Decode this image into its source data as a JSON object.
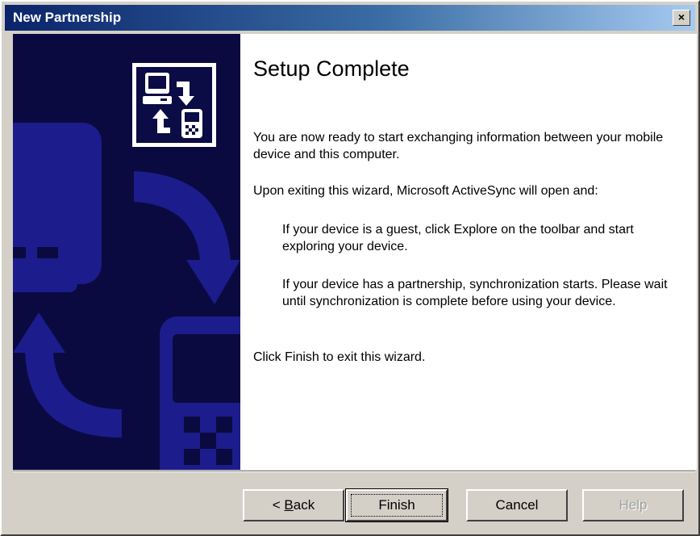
{
  "window": {
    "title": "New Partnership",
    "close_glyph": "×"
  },
  "icons": {
    "banner": "sync-devices-icon",
    "close": "close-icon"
  },
  "colors": {
    "titlebar_start": "#0a246a",
    "titlebar_end": "#a6caf0",
    "banner_bg": "#0a0a40",
    "banner_shapes": "#1c1c8c"
  },
  "content": {
    "heading": "Setup Complete",
    "paragraphs": [
      "You are now ready to start exchanging information between your mobile device and this computer.",
      "Upon exiting this wizard, Microsoft ActiveSync will open and:",
      "If your device is a guest, click Explore on the toolbar and start exploring your device.",
      "If your device has a partnership, synchronization starts. Please wait until synchronization is complete before using your device.",
      "Click Finish to exit this wizard."
    ]
  },
  "buttons": {
    "back_prefix": "< ",
    "back_hotkey": "B",
    "back_rest": "ack",
    "finish": "Finish",
    "cancel": "Cancel",
    "help": "Help"
  }
}
